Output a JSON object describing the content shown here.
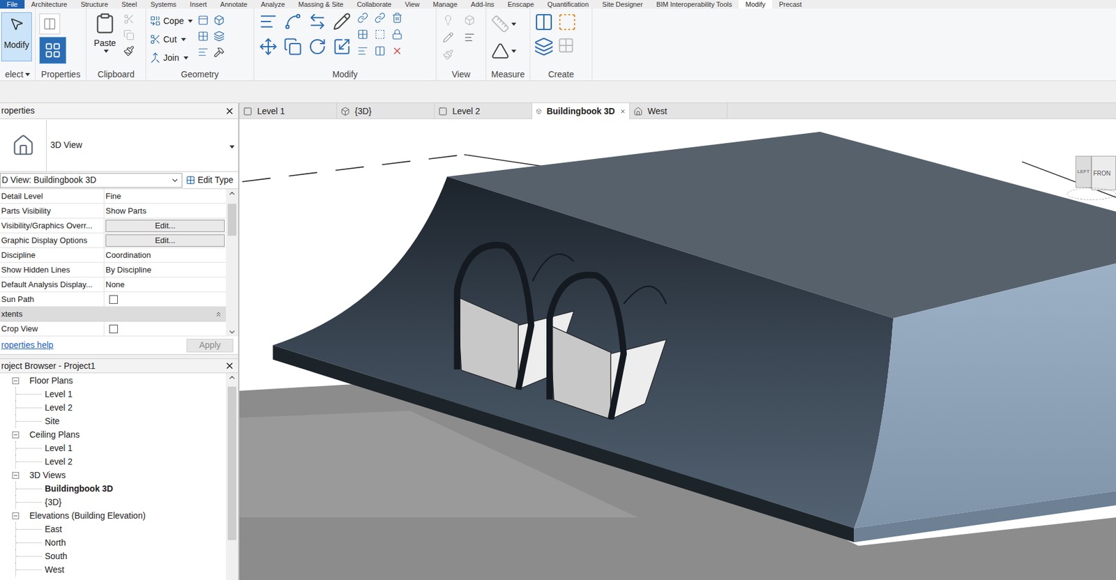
{
  "menu_tabs": [
    {
      "label": "File",
      "kind": "file",
      "selected": false
    },
    {
      "label": "Architecture",
      "kind": "tab",
      "selected": false
    },
    {
      "label": "Structure",
      "kind": "tab",
      "selected": false
    },
    {
      "label": "Steel",
      "kind": "tab",
      "selected": false
    },
    {
      "label": "Systems",
      "kind": "tab",
      "selected": false
    },
    {
      "label": "Insert",
      "kind": "tab",
      "selected": false
    },
    {
      "label": "Annotate",
      "kind": "tab",
      "selected": false
    },
    {
      "label": "Analyze",
      "kind": "tab",
      "selected": false
    },
    {
      "label": "Massing & Site",
      "kind": "tab",
      "selected": false
    },
    {
      "label": "Collaborate",
      "kind": "tab",
      "selected": false
    },
    {
      "label": "View",
      "kind": "tab",
      "selected": false
    },
    {
      "label": "Manage",
      "kind": "tab",
      "selected": false
    },
    {
      "label": "Add-Ins",
      "kind": "tab",
      "selected": false
    },
    {
      "label": "Enscape",
      "kind": "tab",
      "selected": false
    },
    {
      "label": "Quantification",
      "kind": "tab",
      "selected": false
    },
    {
      "label": "Site Designer",
      "kind": "tab",
      "selected": false
    },
    {
      "label": "BIM Interoperability Tools",
      "kind": "tab",
      "selected": false
    },
    {
      "label": "Modify",
      "kind": "tab",
      "selected": true
    },
    {
      "label": "Precast",
      "kind": "tab",
      "selected": false
    }
  ],
  "ribbon": {
    "panels": [
      {
        "label": "elect",
        "kind": "select",
        "dropdown": true,
        "tools": [
          {
            "label": "Modify",
            "selected": true,
            "dropdown": false
          }
        ]
      },
      {
        "label": "Properties",
        "kind": "properties",
        "dropdown": false,
        "tools": []
      },
      {
        "label": "Clipboard",
        "kind": "clipboard",
        "dropdown": false,
        "tools": [
          {
            "label": "Paste",
            "selected": false,
            "dropdown": true
          }
        ]
      },
      {
        "label": "Geometry",
        "kind": "geometry",
        "dropdown": false,
        "tools": [
          {
            "label": "Cope",
            "selected": false,
            "dropdown": true
          },
          {
            "label": "Cut",
            "selected": false,
            "dropdown": true
          },
          {
            "label": "Join",
            "selected": false,
            "dropdown": true
          }
        ]
      },
      {
        "label": "Modify",
        "kind": "modify",
        "dropdown": false,
        "tools": []
      },
      {
        "label": "View",
        "kind": "view",
        "dropdown": false,
        "tools": []
      },
      {
        "label": "Measure",
        "kind": "measure",
        "dropdown": false,
        "tools": []
      },
      {
        "label": "Create",
        "kind": "create",
        "dropdown": false,
        "tools": []
      }
    ]
  },
  "properties": {
    "title": "roperties",
    "type_name": "3D View",
    "selector": "D View: Buildingbook 3D",
    "edit_type": "Edit Type",
    "rows": [
      {
        "label": "Detail Level",
        "value": "Fine",
        "kind": "text"
      },
      {
        "label": "Parts Visibility",
        "value": "Show Parts",
        "kind": "text"
      },
      {
        "label": "Visibility/Graphics Overr...",
        "value": "Edit...",
        "kind": "button"
      },
      {
        "label": "Graphic Display Options",
        "value": "Edit...",
        "kind": "button"
      },
      {
        "label": "Discipline",
        "value": "Coordination",
        "kind": "text"
      },
      {
        "label": "Show Hidden Lines",
        "value": "By Discipline",
        "kind": "text"
      },
      {
        "label": "Default Analysis Display...",
        "value": "None",
        "kind": "text"
      },
      {
        "label": "Sun Path",
        "value": "",
        "kind": "checkbox",
        "checked": false
      },
      {
        "label": "xtents",
        "value": "",
        "kind": "section",
        "expanded": true
      },
      {
        "label": "Crop View",
        "value": "",
        "kind": "checkbox",
        "checked": false
      }
    ],
    "help": "roperties help",
    "apply": {
      "label": "Apply",
      "disabled": true
    }
  },
  "browser": {
    "title": "roject Browser - Project1",
    "items": [
      {
        "label": "Floor Plans",
        "kind": "group",
        "expanded": true,
        "selected": false
      },
      {
        "label": "Level 1",
        "kind": "view",
        "selected": false
      },
      {
        "label": "Level 2",
        "kind": "view",
        "selected": false
      },
      {
        "label": "Site",
        "kind": "view",
        "selected": false
      },
      {
        "label": "Ceiling Plans",
        "kind": "group",
        "expanded": true,
        "selected": false
      },
      {
        "label": "Level 1",
        "kind": "view",
        "selected": false
      },
      {
        "label": "Level 2",
        "kind": "view",
        "selected": false
      },
      {
        "label": "3D Views",
        "kind": "group",
        "expanded": true,
        "selected": false
      },
      {
        "label": "Buildingbook 3D",
        "kind": "view",
        "selected": true
      },
      {
        "label": "{3D}",
        "kind": "view",
        "selected": false
      },
      {
        "label": "Elevations (Building Elevation)",
        "kind": "group",
        "expanded": true,
        "selected": false
      },
      {
        "label": "East",
        "kind": "view",
        "selected": false
      },
      {
        "label": "North",
        "kind": "view",
        "selected": false
      },
      {
        "label": "South",
        "kind": "view",
        "selected": false
      },
      {
        "label": "West",
        "kind": "view",
        "selected": false
      }
    ]
  },
  "view_tabs": [
    {
      "label": "Level 1",
      "kind": "plan",
      "selected": false
    },
    {
      "label": "{3D}",
      "kind": "3d",
      "selected": false
    },
    {
      "label": "Level 2",
      "kind": "plan",
      "selected": false
    },
    {
      "label": "Buildingbook 3D",
      "kind": "3d",
      "selected": true
    },
    {
      "label": "West",
      "kind": "elevation",
      "selected": false
    }
  ],
  "viewcube": {
    "faces": [
      "LEFT",
      "FRON"
    ]
  }
}
